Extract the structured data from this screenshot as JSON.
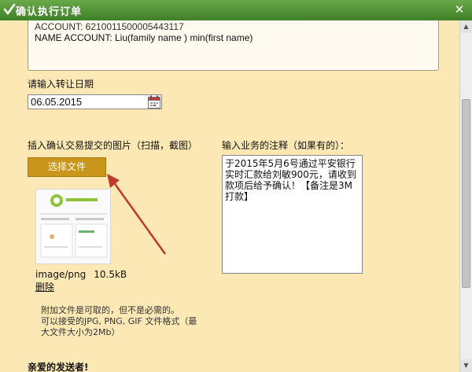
{
  "window": {
    "title": "确认执行订单"
  },
  "account_box": {
    "line1": "ACCOUNT: 6210011500005443117",
    "line2": "NAME ACCOUNT: Liu(family name ) min(first name)"
  },
  "transfer_date": {
    "label": "请输入转让日期",
    "value": "06.05.2015"
  },
  "upload": {
    "label": "插入确认交易提交的图片（扫描，截图）",
    "button_label": "选择文件",
    "file_type": "image/png",
    "file_size": "10.5kB",
    "delete_label": "删除",
    "note_line1": "附加文件是可取的，但不是必需的。",
    "note_line2": "可以接受的JPG, PNG, GIF 文件格式（最大文件大小为2Mb）"
  },
  "notes": {
    "label": "输入业务的注释（如果有的）：",
    "value": "于2015年5月6号通过平安银行实时汇款给刘敏900元，请收到款项后给予确认！【备注是3M打款】"
  },
  "footer": {
    "text": "亲爱的发送者!"
  },
  "colors": {
    "title_bar": "#4e9236",
    "button": "#c9961b",
    "background": "#fbe8b4"
  }
}
